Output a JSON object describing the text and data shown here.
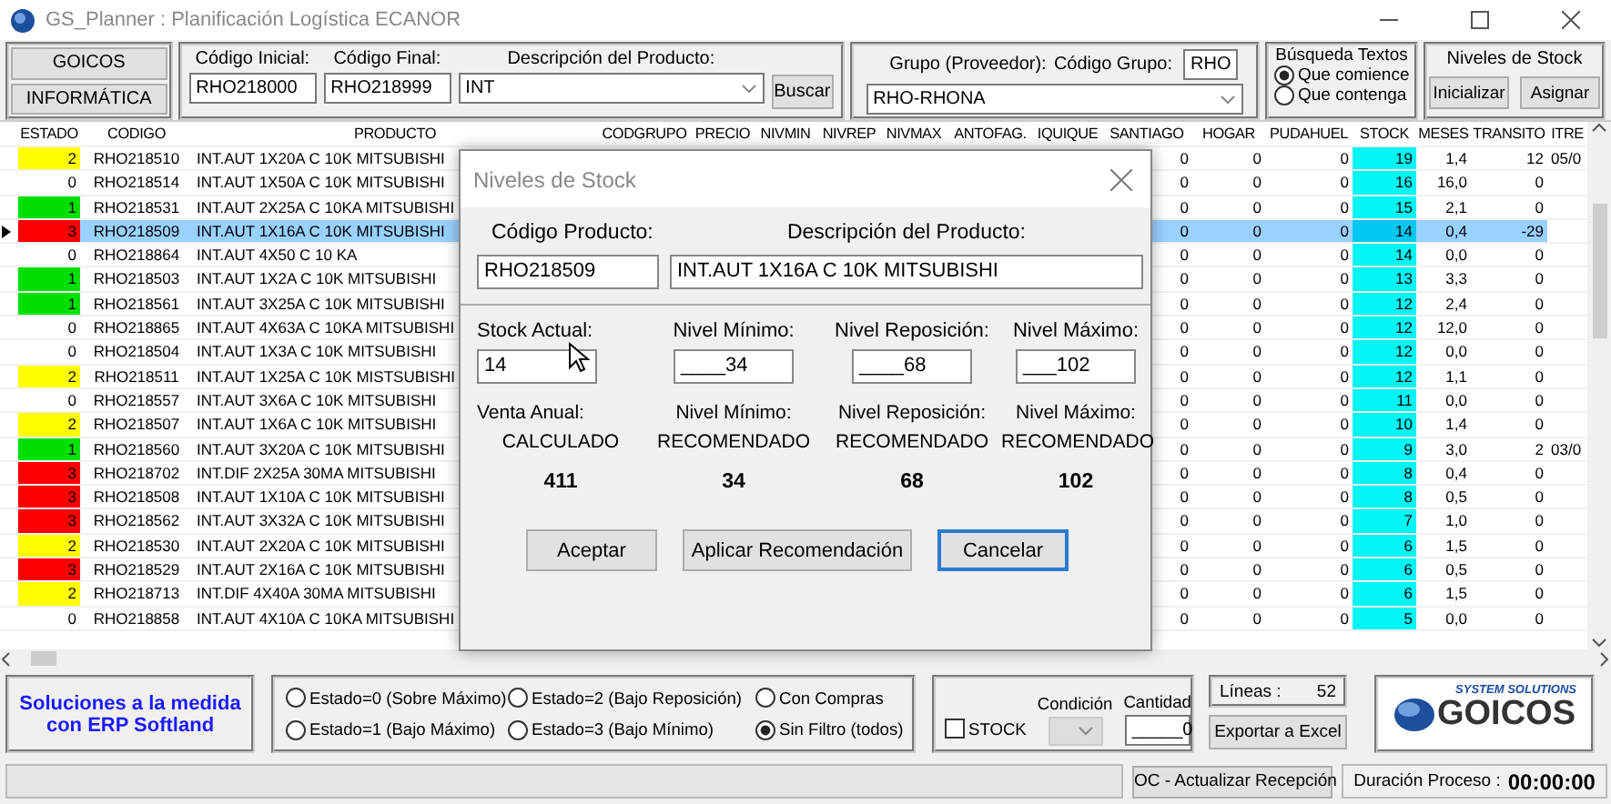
{
  "window": {
    "title": "GS_Planner : Planificación Logística ECANOR"
  },
  "toolbar": {
    "brand_buttons": [
      "GOICOS",
      "INFORMÁTICA"
    ],
    "codigo_inicial": {
      "label": "Código Inicial:",
      "value": "RHO218000"
    },
    "codigo_final": {
      "label": "Código Final:",
      "value": "RHO218999"
    },
    "descripcion": {
      "label": "Descripción del Producto:",
      "value": "INT"
    },
    "buscar": "Buscar",
    "grupo": {
      "label": "Grupo (Proveedor):",
      "value": "RHO-RHONA"
    },
    "codigo_grupo": {
      "label": "Código Grupo:",
      "value": "RHO"
    },
    "busqueda": {
      "title": "Búsqueda Textos",
      "options": [
        {
          "label": "Que comience",
          "selected": true
        },
        {
          "label": "Que contenga",
          "selected": false
        }
      ]
    },
    "niveles": {
      "title": "Niveles de Stock",
      "buttons": [
        "Inicializar",
        "Asignar"
      ]
    }
  },
  "table": {
    "columns": [
      "ESTADO",
      "CODIGO",
      "PRODUCTO",
      "CODGRUPO",
      "PRECIO",
      "NIVMIN",
      "NIVREP",
      "NIVMAX",
      "ANTOFAG.",
      "IQUIQUE",
      "SANTIAGO",
      "HOGAR",
      "PUDAHUEL",
      "STOCK",
      "MESES",
      "TRANSITO",
      "ITRE"
    ],
    "rows": [
      {
        "estado": "2",
        "color": "#ffff00",
        "codigo": "RHO218510",
        "producto": "INT.AUT 1X20A C 10K MITSUBISHI",
        "santiago": "0",
        "hogar": "0",
        "pudahuel": "0",
        "stock": "19",
        "meses": "1,4",
        "transito": "12",
        "itre": "05/0",
        "selected": false
      },
      {
        "estado": "0",
        "color": "#ffffff",
        "codigo": "RHO218514",
        "producto": "INT.AUT 1X50A C 10K MITSUBISHI",
        "santiago": "0",
        "hogar": "0",
        "pudahuel": "0",
        "stock": "16",
        "meses": "16,0",
        "transito": "0",
        "selected": false
      },
      {
        "estado": "1",
        "color": "#00e000",
        "codigo": "RHO218531",
        "producto": "INT.AUT 2X25A C 10KA MITSUBISHI",
        "santiago": "0",
        "hogar": "0",
        "pudahuel": "0",
        "stock": "15",
        "meses": "2,1",
        "transito": "0",
        "selected": false
      },
      {
        "estado": "3",
        "color": "#ff0000",
        "codigo": "RHO218509",
        "producto": "INT.AUT 1X16A C 10K MITSUBISHI",
        "santiago": "0",
        "hogar": "0",
        "pudahuel": "0",
        "stock": "14",
        "meses": "0,4",
        "transito": "-29",
        "selected": true
      },
      {
        "estado": "0",
        "color": "#ffffff",
        "codigo": "RHO218864",
        "producto": "INT.AUT 4X50 C 10 KA",
        "santiago": "0",
        "hogar": "0",
        "pudahuel": "0",
        "stock": "14",
        "meses": "0,0",
        "transito": "0",
        "selected": false
      },
      {
        "estado": "1",
        "color": "#00e000",
        "codigo": "RHO218503",
        "producto": "INT.AUT 1X2A C 10K MITSUBISHI",
        "santiago": "0",
        "hogar": "0",
        "pudahuel": "0",
        "stock": "13",
        "meses": "3,3",
        "transito": "0",
        "selected": false
      },
      {
        "estado": "1",
        "color": "#00e000",
        "codigo": "RHO218561",
        "producto": "INT.AUT 3X25A C 10K MITSUBISHI",
        "santiago": "0",
        "hogar": "0",
        "pudahuel": "0",
        "stock": "12",
        "meses": "2,4",
        "transito": "0",
        "selected": false
      },
      {
        "estado": "0",
        "color": "#ffffff",
        "codigo": "RHO218865",
        "producto": "INT.AUT 4X63A C 10KA MITSUBISHI",
        "santiago": "0",
        "hogar": "0",
        "pudahuel": "0",
        "stock": "12",
        "meses": "12,0",
        "transito": "0",
        "selected": false
      },
      {
        "estado": "0",
        "color": "#ffffff",
        "codigo": "RHO218504",
        "producto": "INT.AUT 1X3A C 10K MITSUBISHI",
        "santiago": "0",
        "hogar": "0",
        "pudahuel": "0",
        "stock": "12",
        "meses": "0,0",
        "transito": "0",
        "selected": false
      },
      {
        "estado": "2",
        "color": "#ffff00",
        "codigo": "RHO218511",
        "producto": "INT.AUT 1X25A C 10K MISTSUBISHI",
        "santiago": "0",
        "hogar": "0",
        "pudahuel": "0",
        "stock": "12",
        "meses": "1,1",
        "transito": "0",
        "selected": false
      },
      {
        "estado": "0",
        "color": "#ffffff",
        "codigo": "RHO218557",
        "producto": "INT.AUT 3X6A C 10K MITSUBISHI",
        "santiago": "0",
        "hogar": "0",
        "pudahuel": "0",
        "stock": "11",
        "meses": "0,0",
        "transito": "0",
        "selected": false
      },
      {
        "estado": "2",
        "color": "#ffff00",
        "codigo": "RHO218507",
        "producto": "INT.AUT 1X6A C 10K MITSUBISHI",
        "santiago": "0",
        "hogar": "0",
        "pudahuel": "0",
        "stock": "10",
        "meses": "1,4",
        "transito": "0",
        "selected": false
      },
      {
        "estado": "1",
        "color": "#00e000",
        "codigo": "RHO218560",
        "producto": "INT.AUT 3X20A C 10K MITSUBISHI",
        "santiago": "0",
        "hogar": "0",
        "pudahuel": "0",
        "stock": "9",
        "meses": "3,0",
        "transito": "2",
        "itre": "03/0",
        "selected": false
      },
      {
        "estado": "3",
        "color": "#ff0000",
        "codigo": "RHO218702",
        "producto": "INT.DIF 2X25A 30MA MITSUBISHI",
        "santiago": "0",
        "hogar": "0",
        "pudahuel": "0",
        "stock": "8",
        "meses": "0,4",
        "transito": "0",
        "selected": false
      },
      {
        "estado": "3",
        "color": "#ff0000",
        "codigo": "RHO218508",
        "producto": "INT.AUT 1X10A C 10K MITSUBISHI",
        "santiago": "0",
        "hogar": "0",
        "pudahuel": "0",
        "stock": "8",
        "meses": "0,5",
        "transito": "0",
        "selected": false
      },
      {
        "estado": "3",
        "color": "#ff0000",
        "codigo": "RHO218562",
        "producto": "INT.AUT 3X32A C 10K MITSUBISHI",
        "santiago": "0",
        "hogar": "0",
        "pudahuel": "0",
        "stock": "7",
        "meses": "1,0",
        "transito": "0",
        "selected": false
      },
      {
        "estado": "2",
        "color": "#ffff00",
        "codigo": "RHO218530",
        "producto": "INT.AUT 2X20A C 10K MITSUBISHI",
        "santiago": "0",
        "hogar": "0",
        "pudahuel": "0",
        "stock": "6",
        "meses": "1,5",
        "transito": "0",
        "selected": false
      },
      {
        "estado": "3",
        "color": "#ff0000",
        "codigo": "RHO218529",
        "producto": "INT.AUT 2X16A C 10K MITSUBISHI",
        "santiago": "0",
        "hogar": "0",
        "pudahuel": "0",
        "stock": "6",
        "meses": "0,5",
        "transito": "0",
        "selected": false
      },
      {
        "estado": "2",
        "color": "#ffff00",
        "codigo": "RHO218713",
        "producto": "INT.DIF 4X40A 30MA MITSUBISHI",
        "santiago": "0",
        "hogar": "0",
        "pudahuel": "0",
        "stock": "6",
        "meses": "1,5",
        "transito": "0",
        "selected": false
      },
      {
        "estado": "0",
        "color": "#ffffff",
        "codigo": "RHO218858",
        "producto": "INT.AUT 4X10A C 10KA MITSUBISHI",
        "santiago": "0",
        "hogar": "0",
        "pudahuel": "0",
        "stock": "5",
        "meses": "0,0",
        "transito": "0",
        "selected": false
      }
    ]
  },
  "dialog": {
    "title": "Niveles de Stock",
    "codigo": {
      "label": "Código Producto:",
      "value": "RHO218509"
    },
    "descripcion": {
      "label": "Descripción del Producto:",
      "value": "INT.AUT 1X16A C 10K MITSUBISHI"
    },
    "levels": [
      {
        "label": "Stock Actual:",
        "value": "14"
      },
      {
        "label": "Nivel Mínimo:",
        "value": "____34"
      },
      {
        "label": "Nivel Reposición:",
        "value": "____68"
      },
      {
        "label": "Nivel Máximo:",
        "value": "___102"
      }
    ],
    "recommended": [
      {
        "label": "Venta Anual:",
        "sub": "CALCULADO",
        "value": "411"
      },
      {
        "label": "Nivel Mínimo:",
        "sub": "RECOMENDADO",
        "value": "34"
      },
      {
        "label": "Nivel Reposición:",
        "sub": "RECOMENDADO",
        "value": "68"
      },
      {
        "label": "Nivel Máximo:",
        "sub": "RECOMENDADO",
        "value": "102"
      }
    ],
    "buttons": [
      {
        "label": "Aceptar",
        "default": false
      },
      {
        "label": "Aplicar Recomendación",
        "default": false
      },
      {
        "label": "Cancelar",
        "default": true
      }
    ]
  },
  "bottom": {
    "promo": [
      "Soluciones a la medida",
      "con ERP Softland"
    ],
    "filters": [
      {
        "label": "Estado=0 (Sobre Máximo)",
        "selected": false
      },
      {
        "label": "Estado=2 (Bajo Reposición)",
        "selected": false
      },
      {
        "label": "Con Compras",
        "selected": false
      },
      {
        "label": "Estado=1 (Bajo Máximo)",
        "selected": false
      },
      {
        "label": "Estado=3 (Bajo Mínimo)",
        "selected": false
      },
      {
        "label": "Sin Filtro (todos)",
        "selected": true
      }
    ],
    "stock": {
      "label": "STOCK",
      "checked": false
    },
    "condicion": {
      "label": "Condición"
    },
    "cantidad": {
      "label": "Cantidad",
      "value": "_____0"
    },
    "lineas": {
      "label": "Líneas :",
      "value": "52"
    },
    "export": "Exportar a Excel",
    "logo": {
      "tagline": "SYSTEM SOLUTIONS",
      "name": "GOICOS"
    }
  },
  "status_bar": {
    "progress": {
      "level": 0
    },
    "oc_button": "OC - Actualizar Recepción",
    "duracion": {
      "label": "Duración Proceso :",
      "value": "00:00:00"
    }
  }
}
